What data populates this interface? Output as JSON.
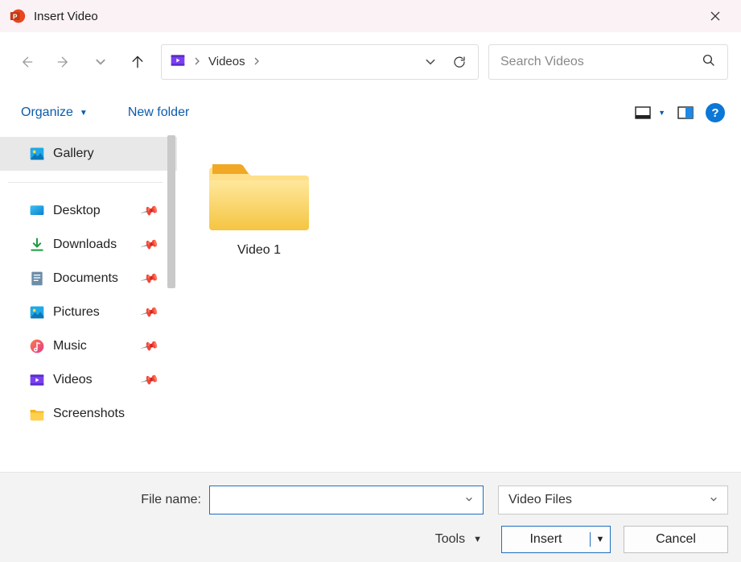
{
  "window": {
    "title": "Insert Video"
  },
  "address": {
    "location": "Videos"
  },
  "search": {
    "placeholder": "Search Videos"
  },
  "toolbar": {
    "organize": "Organize",
    "new_folder": "New folder"
  },
  "sidebar": {
    "top": {
      "label": "Gallery"
    },
    "items": [
      {
        "label": "Desktop"
      },
      {
        "label": "Downloads"
      },
      {
        "label": "Documents"
      },
      {
        "label": "Pictures"
      },
      {
        "label": "Music"
      },
      {
        "label": "Videos"
      },
      {
        "label": "Screenshots"
      }
    ]
  },
  "files": {
    "item0": {
      "label": "Video 1"
    }
  },
  "bottom": {
    "filename_label": "File name:",
    "filename_value": "",
    "filter_label": "Video Files",
    "tools": "Tools",
    "insert": "Insert",
    "cancel": "Cancel"
  }
}
